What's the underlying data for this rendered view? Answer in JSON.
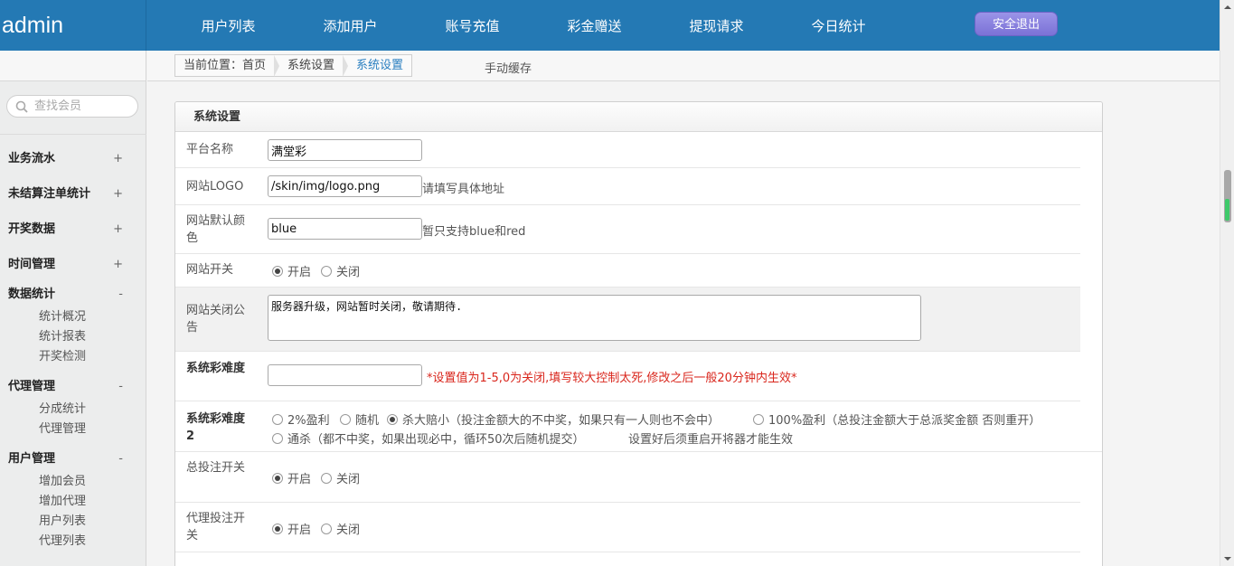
{
  "app": {
    "brand": "admin"
  },
  "top_nav": {
    "items": [
      "用户列表",
      "添加用户",
      "账号充值",
      "彩金赠送",
      "提现请求",
      "今日统计"
    ],
    "logout_label": "安全退出"
  },
  "sidebar": {
    "search_placeholder": "查找会员",
    "groups": [
      {
        "title": "业务流水",
        "toggle": "+"
      },
      {
        "title": "未结算注单统计",
        "toggle": "+"
      },
      {
        "title": "开奖数据",
        "toggle": "+"
      },
      {
        "title": "时间管理",
        "toggle": "+"
      },
      {
        "title": "数据统计",
        "toggle": "-",
        "items": [
          "统计概况",
          "统计报表",
          "开奖检测"
        ]
      },
      {
        "title": "代理管理",
        "toggle": "-",
        "items": [
          "分成统计",
          "代理管理"
        ]
      },
      {
        "title": "用户管理",
        "toggle": "-",
        "items": [
          "增加会员",
          "增加代理",
          "用户列表",
          "代理列表"
        ]
      }
    ]
  },
  "breadcrumb": {
    "prefix": "当前位置：",
    "home": "首页",
    "section": "系统设置",
    "current": "系统设置",
    "extra": "手动缓存"
  },
  "panel": {
    "title": "系统设置",
    "fields": {
      "platform_name": {
        "label": "平台名称",
        "value": "满堂彩"
      },
      "site_logo": {
        "label": "网站LOGO",
        "value": "/skin/img/logo.png",
        "hint": "请填写具体地址"
      },
      "site_color": {
        "label": "网站默认颜色",
        "value": "blue",
        "hint": "暂只支持blue和red"
      },
      "site_switch": {
        "label": "网站开关",
        "options": [
          "开启",
          "关闭"
        ],
        "selected": "开启"
      },
      "close_notice": {
        "label": "网站关闭公告",
        "value": "服务器升级，网站暂时关闭，敬请期待."
      },
      "difficulty": {
        "label": "系统彩难度",
        "value": "",
        "hint": "*设置值为1-5,0为关闭,填写较大控制太死,修改之后一般20分钟内生效*"
      },
      "difficulty2": {
        "label": "系统彩难度2",
        "options": [
          "2%盈利",
          "随机",
          "杀大赔小（投注金额大的不中奖，如果只有一人则也不会中）",
          "100%盈利（总投注金额大于总派奖金额 否则重开）",
          "通杀（都不中奖，如果出现必中，循环50次后随机提交）"
        ],
        "selected": "杀大赔小（投注金额大的不中奖，如果只有一人则也不会中）",
        "hint": "设置好后须重启开将器才能生效"
      },
      "bet_switch": {
        "label": "总投注开关",
        "options": [
          "开启",
          "关闭"
        ],
        "selected": "开启"
      },
      "agent_bet_switch": {
        "label": "代理投注开关",
        "options": [
          "开启",
          "关闭"
        ],
        "selected": "开启"
      }
    }
  },
  "colors": {
    "topbar": "#2479b4",
    "logout": "#8a82e0",
    "warning": "#d9261c",
    "link": "#2a7fc0"
  }
}
